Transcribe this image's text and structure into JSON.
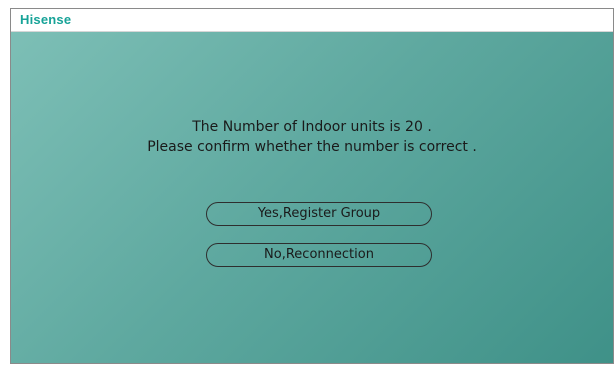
{
  "header": {
    "brand": "Hisense"
  },
  "dialog": {
    "line1": "The Number of Indoor units is 20 .",
    "line2": "Please confirm whether the number is correct ."
  },
  "buttons": {
    "yes_label": "Yes,Register Group",
    "no_label": "No,Reconnection"
  },
  "colors": {
    "brand": "#17a398",
    "background_light": "#7dbfb6",
    "background_dark": "#3f9188"
  }
}
